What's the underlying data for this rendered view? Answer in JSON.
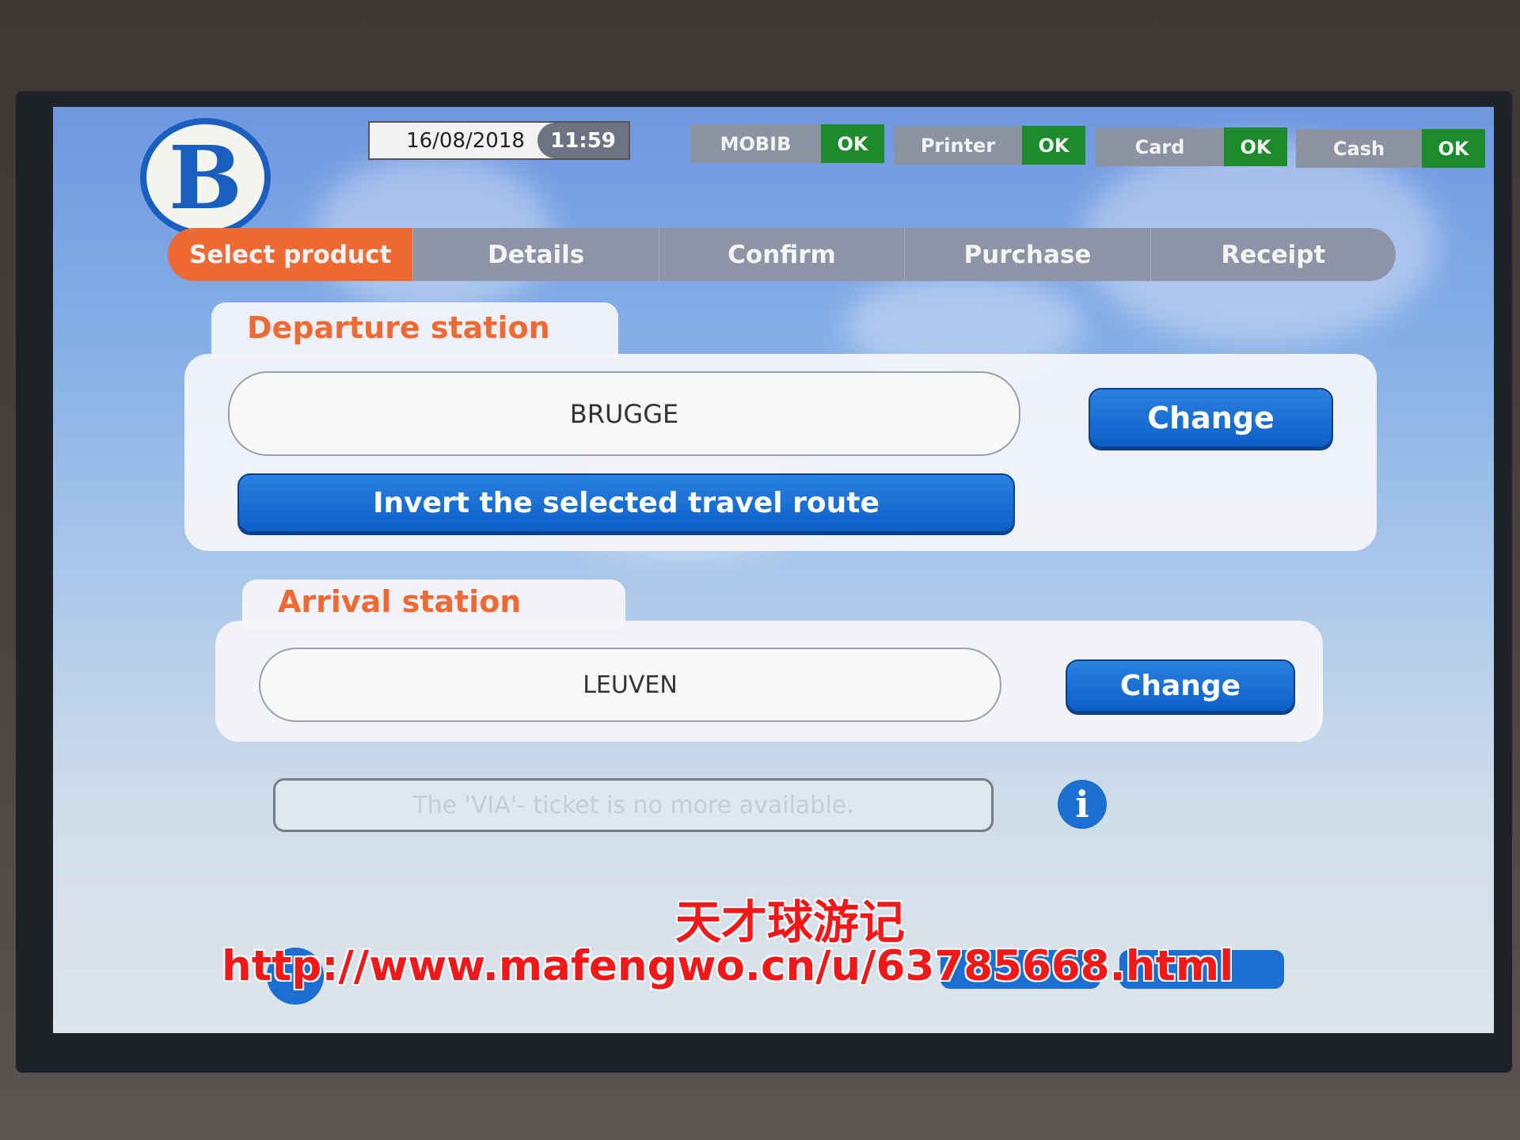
{
  "header": {
    "logo_letter": "B",
    "date": "16/08/2018",
    "time": "11:59",
    "status": [
      {
        "label": "MOBIB",
        "state": "OK"
      },
      {
        "label": "Printer",
        "state": "OK"
      },
      {
        "label": "Card",
        "state": "OK"
      },
      {
        "label": "Cash",
        "state": "OK"
      }
    ]
  },
  "steps": [
    {
      "label": "Select product",
      "active": true
    },
    {
      "label": "Details"
    },
    {
      "label": "Confirm"
    },
    {
      "label": "Purchase"
    },
    {
      "label": "Receipt"
    }
  ],
  "departure": {
    "title": "Departure station",
    "value": "BRUGGE",
    "change_label": "Change",
    "invert_label": "Invert the selected travel route"
  },
  "arrival": {
    "title": "Arrival station",
    "value": "LEUVEN",
    "change_label": "Change"
  },
  "via": {
    "placeholder": "The 'VIA'- ticket is no more available."
  },
  "watermark": {
    "line1": "天才球游记",
    "line2": "http://www.mafengwo.cn/u/63785668.html"
  },
  "colors": {
    "accent": "#ee6a35",
    "button": "#1a6fd0",
    "ok": "#1e8a2e",
    "brand": "#1a5fc0"
  }
}
